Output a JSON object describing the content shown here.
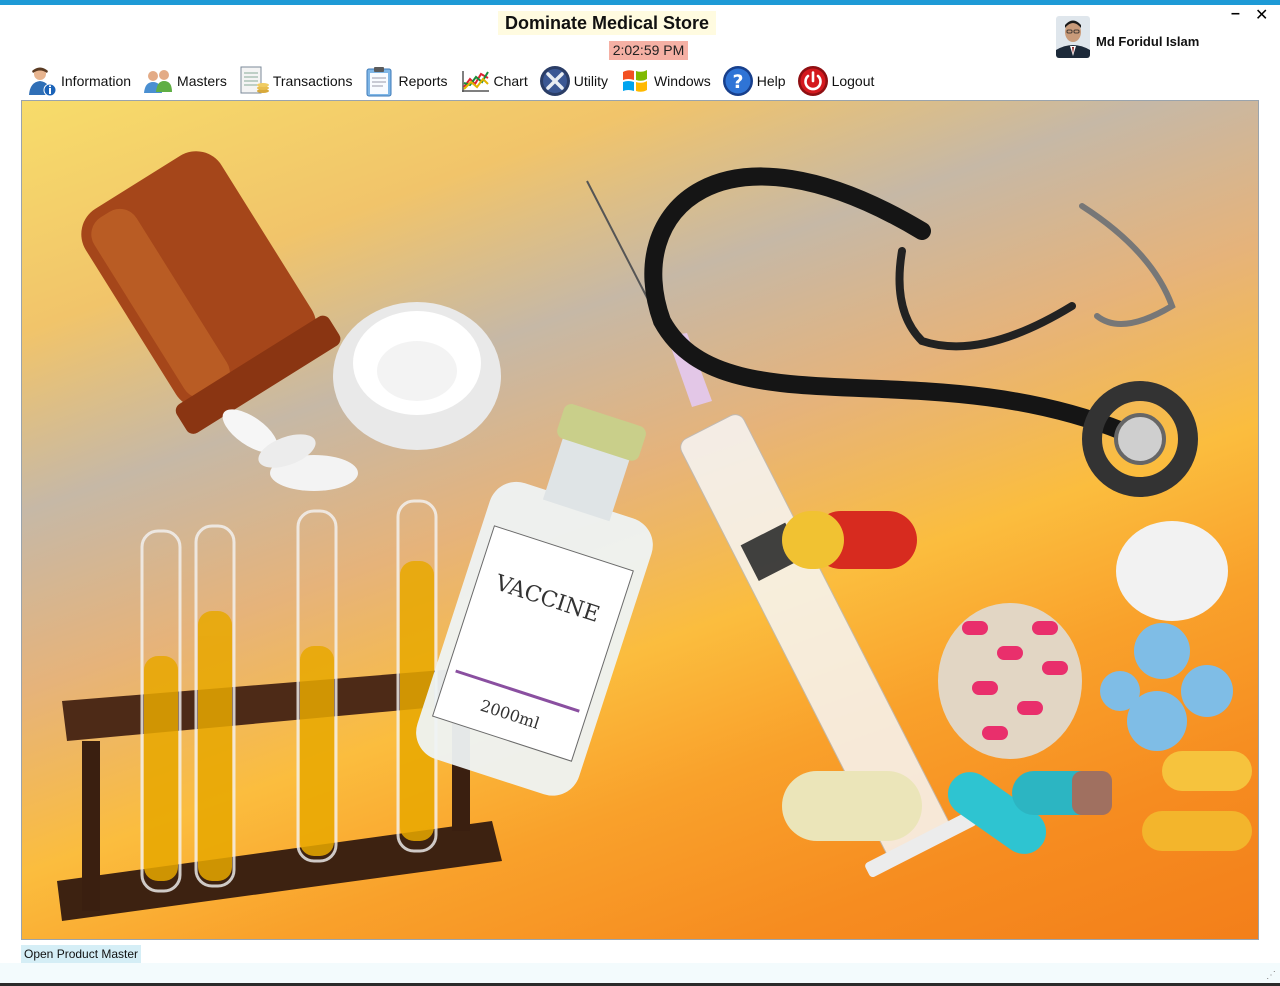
{
  "app": {
    "title": "Dominate Medical Store",
    "time": "2:02:59 PM",
    "user_name": "Md Foridul Islam"
  },
  "window_controls": {
    "minimize": "–",
    "close": "✕"
  },
  "menu": [
    {
      "label": "Information",
      "icon": "user-info-icon"
    },
    {
      "label": "Masters",
      "icon": "users-group-icon"
    },
    {
      "label": "Transactions",
      "icon": "ledger-icon"
    },
    {
      "label": "Reports",
      "icon": "clipboard-report-icon"
    },
    {
      "label": "Chart",
      "icon": "line-chart-icon"
    },
    {
      "label": "Utility",
      "icon": "tools-icon"
    },
    {
      "label": "Windows",
      "icon": "windows-logo-icon"
    },
    {
      "label": "Help",
      "icon": "help-icon"
    },
    {
      "label": "Logout",
      "icon": "power-icon"
    }
  ],
  "background_image": {
    "description_icon": "medical-collage-image"
  },
  "status_bar": {
    "message": "Open Product Master"
  },
  "colors": {
    "accent_top": "#1e9ad6",
    "title_bg": "#fffbe0",
    "clock_bg": "#f5b0a4",
    "status_bg": "#d5eef6"
  }
}
